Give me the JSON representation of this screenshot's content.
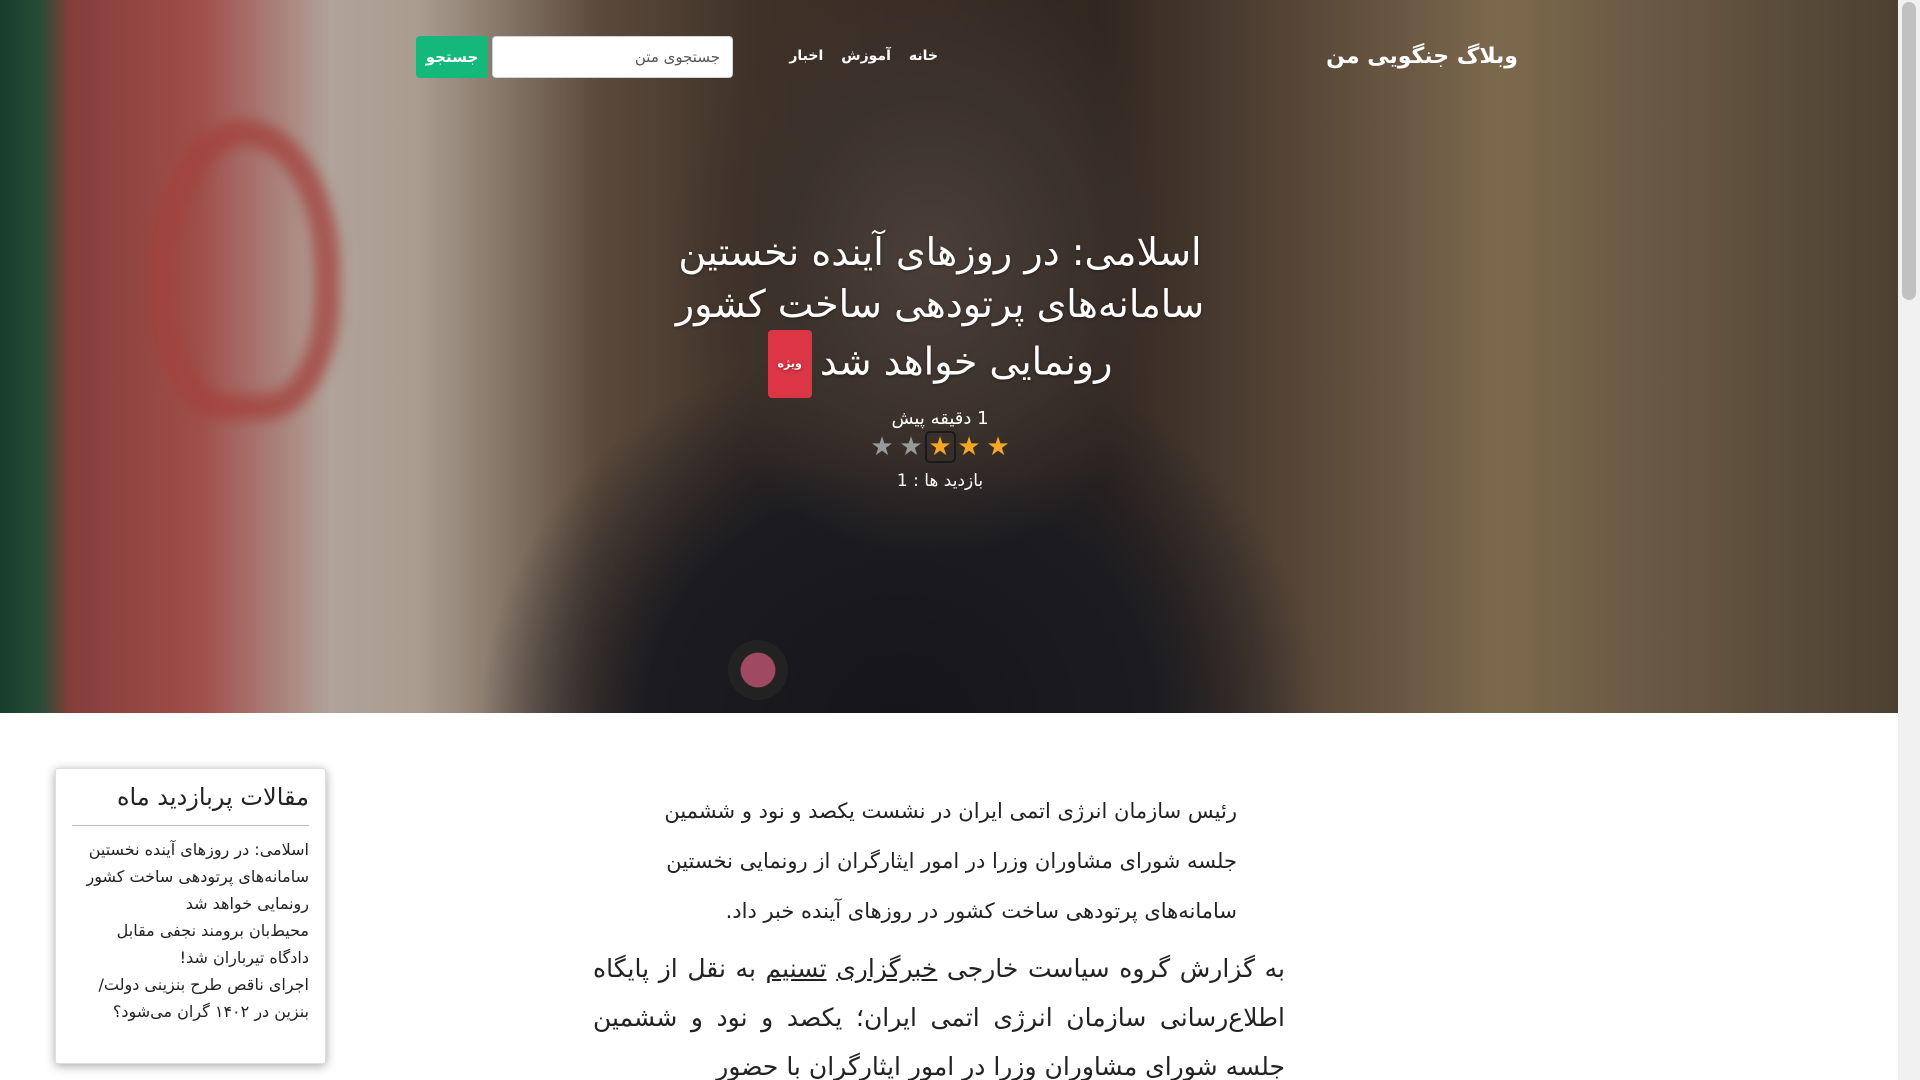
{
  "navbar": {
    "brand": "وبلاگ جنگویی من",
    "links": [
      "خانه",
      "آموزش",
      "اخبار"
    ],
    "search_placeholder": "جستجوی متن",
    "search_button": "جستجو"
  },
  "post": {
    "title": "اسلامی: در روزهای آینده نخستین سامانه‌های پرتودهی ساخت کشور رونمایی خواهد شد",
    "badge": "ویژه",
    "time": "1 دقیقه پیش",
    "rating": {
      "value": 3,
      "max": 5
    },
    "views": "بازدید ها : 1"
  },
  "sidebar": {
    "title": "مقالات پربازدید ماه",
    "items": [
      "اسلامی: در روزهای آینده نخستین سامانه‌های پرتودهی ساخت کشور رونمایی خواهد شد",
      "محیط‌بان برومند نجفی مقابل دادگاه تیرباران شد!",
      "اجرای ناقص طرح بنزینی دولت/ بنزین در ۱۴۰۲ گران می‌شود؟"
    ]
  },
  "article": {
    "lead": "رئیس سازمان انرژی اتمی ایران در نشست یکصد و نود و ششمین جلسه شورای مشاوران وزرا در امور ایثارگران از رونمایی نخستین سامانه‌های پرتودهی ساخت کشور در روزهای آینده خبر داد.",
    "body_before": "به گزارش گروه سیاست خارجی ",
    "link1": "خبرگزاری",
    "link2": "تسنیم",
    "body_after": " به نقل از پایگاه اطلاع‌رسانی سازمان انرژی اتمی ایران؛ یکصد و نود و ششمین جلسه شورای مشاوران وزرا در امور ایثارگران با حضور"
  },
  "colors": {
    "accent": "#14b87a",
    "badge": "#dc3545",
    "star_on": "#f5a623",
    "star_off": "#9a9a9a"
  },
  "icons": [
    "star-icon"
  ]
}
